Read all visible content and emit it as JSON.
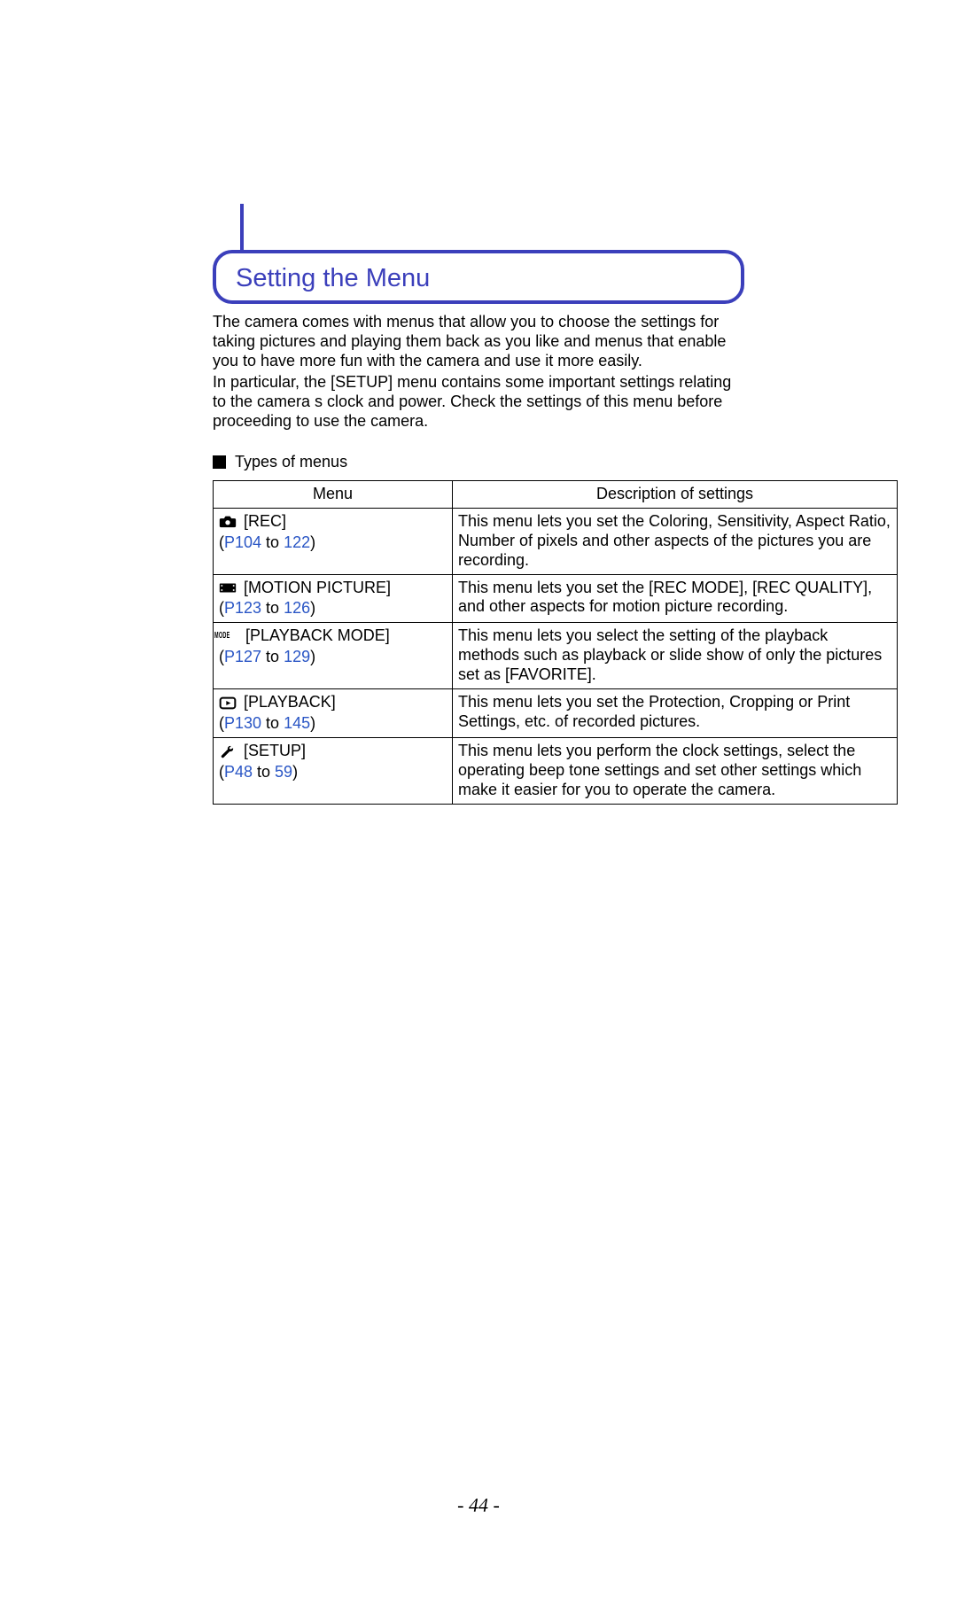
{
  "heading": "Setting the Menu",
  "intro": {
    "p1": "The camera comes with menus that allow you to choose the settings for taking pictures and playing them back as you like and menus that enable you to have more fun with the camera and use it more easily.",
    "p2": "In particular, the [SETUP] menu contains some important settings relating to the camera s clock and power. Check the settings of this menu before proceeding to use the camera."
  },
  "subheading": "Types of menus",
  "table": {
    "header": {
      "menu": "Menu",
      "desc": "Description of settings"
    },
    "rows": [
      {
        "icon_name": "camera-icon",
        "label": "[REC]",
        "ref_prefix": "(",
        "ref_link1": "P104",
        "ref_mid": " to ",
        "ref_link2": "122",
        "ref_suffix": ")",
        "desc": "This menu lets you set the Coloring, Sensitivity, Aspect Ratio, Number of pixels and other aspects of the pictures you are recording."
      },
      {
        "icon_name": "movie-icon",
        "label": "[MOTION PICTURE]",
        "ref_prefix": "(",
        "ref_link1": "P123",
        "ref_mid": " to ",
        "ref_link2": "126",
        "ref_suffix": ")",
        "desc": "This menu lets you set the [REC MODE], [REC QUALITY], and other aspects for motion picture recording."
      },
      {
        "icon_name": "mode-icon",
        "label": "[PLAYBACK MODE]",
        "ref_prefix": "(",
        "ref_link1": "P127",
        "ref_mid": " to ",
        "ref_link2": "129",
        "ref_suffix": ")",
        "desc": "This menu lets you select the setting of the playback methods such as playback or slide show of only the pictures set as [FAVORITE]."
      },
      {
        "icon_name": "playback-icon",
        "label": "[PLAYBACK]",
        "ref_prefix": "(",
        "ref_link1": "P130",
        "ref_mid": " to ",
        "ref_link2": "145",
        "ref_suffix": ")",
        "desc": "This menu lets you set the Protection, Cropping or Print Settings, etc. of recorded pictures."
      },
      {
        "icon_name": "setup-icon",
        "label": "[SETUP]",
        "ref_prefix": "(",
        "ref_link1": "P48",
        "ref_mid": " to ",
        "ref_link2": "59",
        "ref_suffix": ")",
        "desc": "This menu lets you perform the clock settings, select the operating beep tone settings and set other settings which make it easier for you to operate the camera."
      }
    ]
  },
  "mode_glyph": "MODE",
  "page_number": "- 44 -"
}
